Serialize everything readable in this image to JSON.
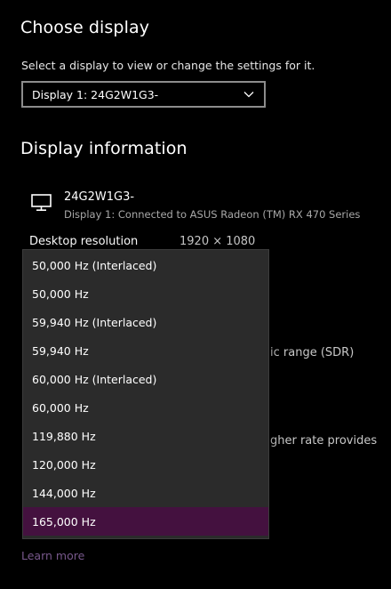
{
  "choose_display": {
    "heading": "Choose display",
    "subtitle": "Select a display to view or change the settings for it.",
    "selected_display": "Display 1: 24G2W1G3-"
  },
  "display_information": {
    "heading": "Display information",
    "device_name": "24G2W1G3-",
    "device_description": "Display 1: Connected to ASUS Radeon (TM) RX 470 Series",
    "desktop_resolution_label": "Desktop resolution",
    "desktop_resolution_value": "1920 × 1080",
    "color_space_partial": "ic range (SDR)",
    "refresh_note_partial": "gher rate provides"
  },
  "refresh_rate_dropdown": {
    "options": [
      "50,000 Hz (Interlaced)",
      "50,000 Hz",
      "59,940 Hz (Interlaced)",
      "59,940 Hz",
      "60,000 Hz (Interlaced)",
      "60,000 Hz",
      "119,880 Hz",
      "120,000 Hz",
      "144,000 Hz",
      "165,000 Hz"
    ],
    "selected": "165,000 Hz"
  },
  "learn_more": "Learn more",
  "colors": {
    "background": "#000000",
    "dropdown_bg": "#2b2b2b",
    "selected_bg": "#44113f",
    "link": "#7a5a8e"
  }
}
